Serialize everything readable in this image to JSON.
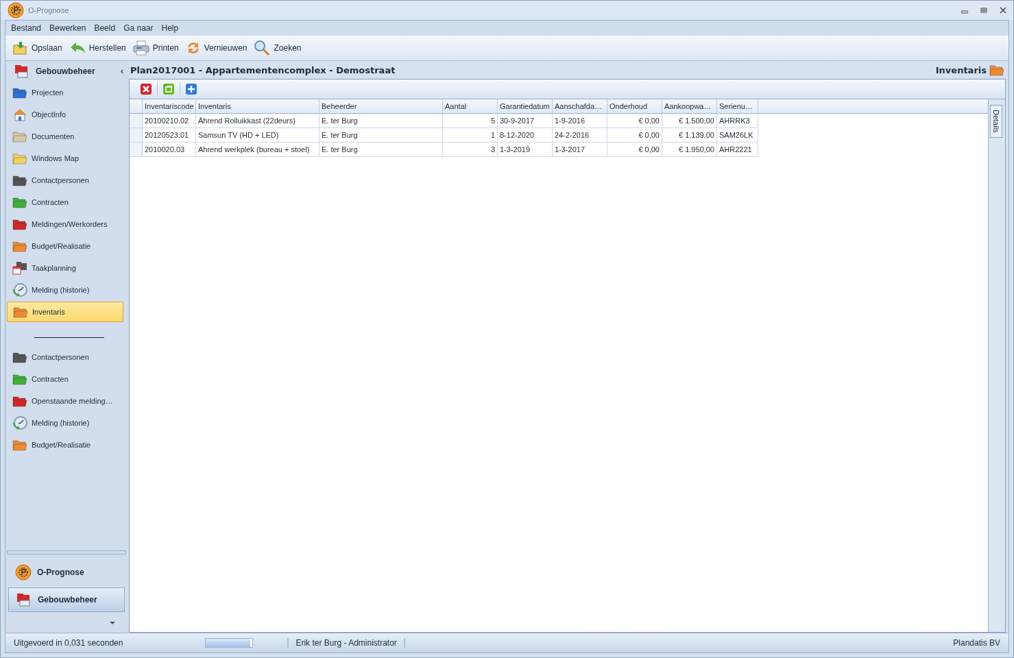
{
  "window": {
    "title": "O-Prognose"
  },
  "menu": [
    "Bestand",
    "Bewerken",
    "Beeld",
    "Ga naar",
    "Help"
  ],
  "toolbar": [
    {
      "label": "Opslaan",
      "kind": "save"
    },
    {
      "label": "Herstellen",
      "kind": "undo"
    },
    {
      "label": "Printen",
      "kind": "print"
    },
    {
      "label": "Vernieuwen",
      "kind": "refresh"
    },
    {
      "label": "Zoeken",
      "kind": "search"
    }
  ],
  "sidebar": {
    "title": "Gebouwbeheer",
    "collapse": "‹",
    "items": [
      {
        "label": "Projecten",
        "kind": "folder",
        "color": "#2f6fd0",
        "selected": false
      },
      {
        "label": "ObjectInfo",
        "kind": "house",
        "selected": false
      },
      {
        "label": "Documenten",
        "kind": "folder",
        "color": "#d9c8a8",
        "selected": false
      },
      {
        "label": "Windows Map",
        "kind": "folder",
        "color": "#f2d060",
        "selected": false
      },
      {
        "label": "Contactpersonen",
        "kind": "folder",
        "color": "#555555",
        "selected": false
      },
      {
        "label": "Contracten",
        "kind": "folder",
        "color": "#3fb03a",
        "selected": false
      },
      {
        "label": "Meldingen/Werkorders",
        "kind": "folder",
        "color": "#d02828",
        "selected": false
      },
      {
        "label": "Budget/Realisatie",
        "kind": "folder",
        "color": "#f08a30",
        "selected": false
      },
      {
        "label": "Taakplanning",
        "kind": "calendar",
        "selected": false
      },
      {
        "label": "Melding (historie)",
        "kind": "clock",
        "selected": false
      },
      {
        "label": "Inventaris",
        "kind": "folder",
        "color": "#f08a30",
        "selected": true
      }
    ],
    "items_2": [
      {
        "label": "Contactpersonen",
        "kind": "folder",
        "color": "#555555"
      },
      {
        "label": "Contracten",
        "kind": "folder",
        "color": "#3fb03a"
      },
      {
        "label": "Openstaande melding…",
        "kind": "folder",
        "color": "#d02828"
      },
      {
        "label": "Melding (historie)",
        "kind": "clock"
      },
      {
        "label": "Budget/Realisatie",
        "kind": "folder",
        "color": "#f08a30"
      }
    ],
    "modules": [
      {
        "label": "O-Prognose",
        "kind": "prognose",
        "selected": false
      },
      {
        "label": "Gebouwbeheer",
        "kind": "building",
        "selected": true
      }
    ]
  },
  "content": {
    "title": "Plan2017001 - Appartementencomplex - Demostraat",
    "section": "Inventaris",
    "actions": [
      {
        "kind": "delete"
      },
      {
        "kind": "window"
      },
      {
        "kind": "add"
      }
    ],
    "side_tab": "Details",
    "table": {
      "columns": [
        {
          "label": "Inventariscode",
          "kind": "text"
        },
        {
          "label": "Inventaris",
          "kind": "text"
        },
        {
          "label": "Beheerder",
          "kind": "text"
        },
        {
          "label": "Aantal",
          "kind": "number"
        },
        {
          "label": "Garantiedatum",
          "kind": "text"
        },
        {
          "label": "Aanschafda…",
          "kind": "text"
        },
        {
          "label": "Onderhoud",
          "kind": "number"
        },
        {
          "label": "Aankoopwa…",
          "kind": "number"
        },
        {
          "label": "Serienu…",
          "kind": "text"
        }
      ],
      "rows": [
        [
          "20100210.02",
          "Àhrend Rolluikkast (22deurs)",
          "E. ter Burg",
          "5",
          "30-9-2017",
          "1-9-2016",
          "€ 0,00",
          "€ 1.500,00",
          "AHRRK3"
        ],
        [
          "20120523.01",
          "Samsun TV (HD + LED)",
          "E. ter Burg",
          "1",
          "8-12-2020",
          "24-2-2016",
          "€ 0,00",
          "€ 1.139,00",
          "SAM26LK"
        ],
        [
          "2010020.03",
          "Ahrend werkplek (bureau + stoel)",
          "E. ter Burg",
          "3",
          "1-3-2019",
          "1-3-2017",
          "€ 0,00",
          "€ 1.950,00",
          "AHR2221"
        ]
      ]
    }
  },
  "status_bar": {
    "message": "Uitgevoerd in 0,031 seconden",
    "level": 0.95,
    "user": "Erik ter Burg - Administrator",
    "company": "Plandatis BV"
  }
}
